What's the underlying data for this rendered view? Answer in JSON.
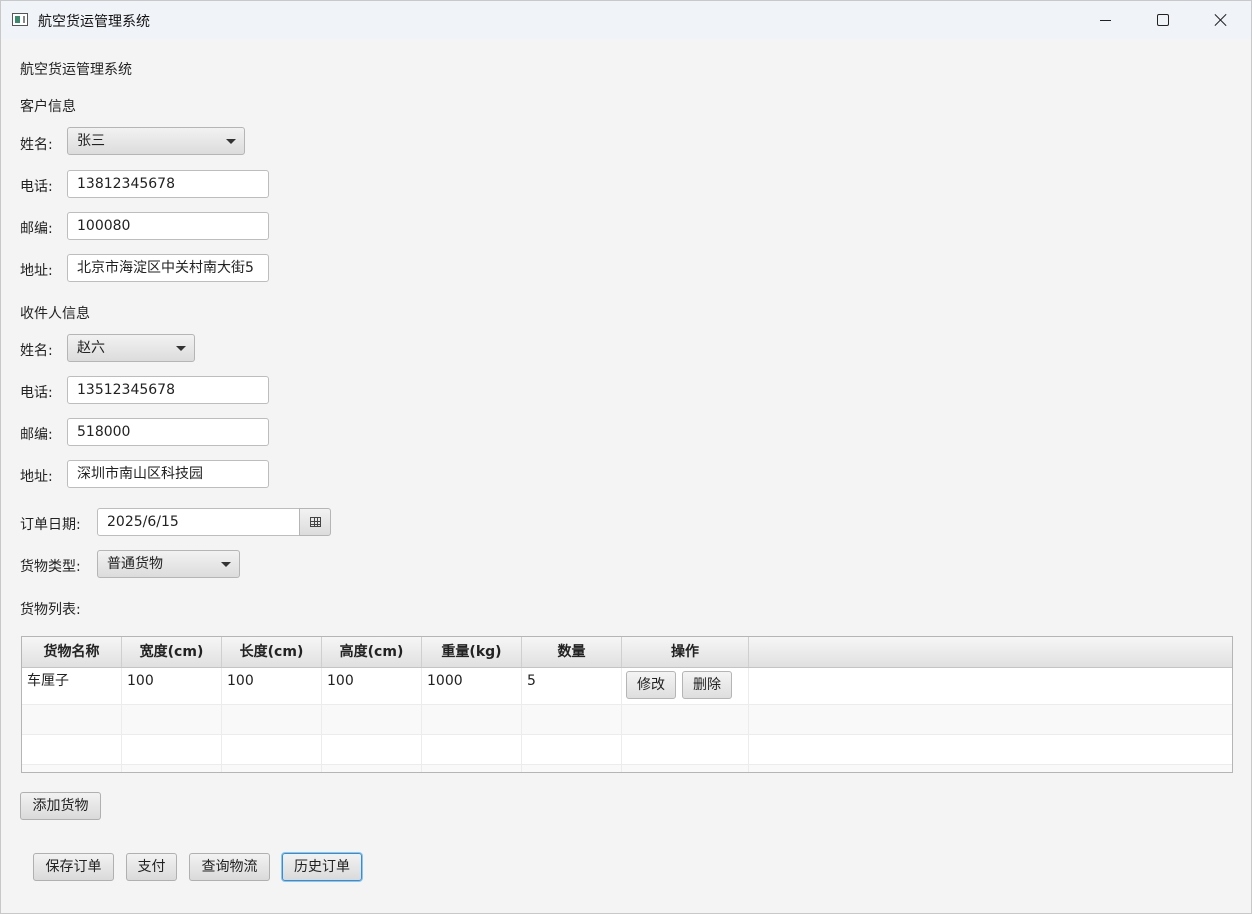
{
  "window": {
    "title": "航空货运管理系统"
  },
  "header": {
    "title": "航空货运管理系统"
  },
  "customer": {
    "section_title": "客户信息",
    "name_label": "姓名:",
    "name_value": "张三",
    "phone_label": "电话:",
    "phone_value": "13812345678",
    "zip_label": "邮编:",
    "zip_value": "100080",
    "address_label": "地址:",
    "address_value": "北京市海淀区中关村南大街5"
  },
  "recipient": {
    "section_title": "收件人信息",
    "name_label": "姓名:",
    "name_value": "赵六",
    "phone_label": "电话:",
    "phone_value": "13512345678",
    "zip_label": "邮编:",
    "zip_value": "518000",
    "address_label": "地址:",
    "address_value": "深圳市南山区科技园"
  },
  "order": {
    "date_label": "订单日期:",
    "date_value": "2025/6/15",
    "cargo_type_label": "货物类型:",
    "cargo_type_value": "普通货物",
    "cargo_list_label": "货物列表:"
  },
  "cargo_table": {
    "columns": [
      "货物名称",
      "宽度(cm)",
      "长度(cm)",
      "高度(cm)",
      "重量(kg)",
      "数量",
      "操作"
    ],
    "rows": [
      {
        "name": "车厘子",
        "width": "100",
        "length": "100",
        "height": "100",
        "weight": "1000",
        "qty": "5",
        "edit_label": "修改",
        "delete_label": "删除"
      }
    ]
  },
  "actions": {
    "add_cargo": "添加货物",
    "save_order": "保存订单",
    "pay": "支付",
    "track": "查询物流",
    "history": "历史订单"
  }
}
